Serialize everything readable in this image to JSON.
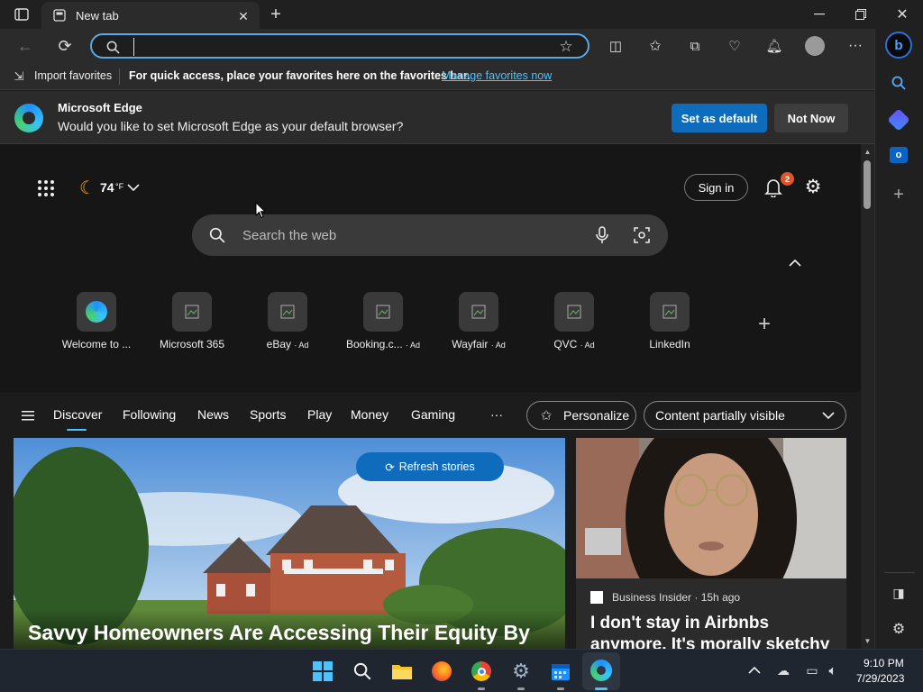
{
  "tab": {
    "title": "New tab"
  },
  "address": {
    "placeholder": "",
    "value": ""
  },
  "favorites": {
    "import_label": "Import favorites",
    "hint": "For quick access, place your favorites here on the favorites bar.",
    "manage_link": "Manage favorites now"
  },
  "infobar": {
    "title": "Microsoft Edge",
    "message": "Would you like to set Microsoft Edge as your default browser?",
    "primary": "Set as default",
    "secondary": "Not Now"
  },
  "ntp": {
    "weather": "74",
    "weather_unit": "°F",
    "sign_in": "Sign in",
    "notification_count": "2",
    "search_placeholder": "Search the web",
    "top_sites": [
      {
        "label": "Welcome to ...",
        "ad": ""
      },
      {
        "label": "Microsoft 365",
        "ad": ""
      },
      {
        "label": "eBay",
        "ad": "· Ad"
      },
      {
        "label": "Booking.c...",
        "ad": "· Ad"
      },
      {
        "label": "Wayfair",
        "ad": "· Ad"
      },
      {
        "label": "QVC",
        "ad": "· Ad"
      },
      {
        "label": "LinkedIn",
        "ad": ""
      }
    ],
    "nav_tabs": [
      "Discover",
      "Following",
      "News",
      "Sports",
      "Play",
      "Money",
      "Gaming"
    ],
    "more": "···",
    "personalize": "Personalize",
    "content_visibility": "Content partially visible",
    "refresh": "Refresh stories",
    "main_story_title": "Savvy Homeowners Are Accessing Their Equity By",
    "side_story": {
      "source": "Business Insider · 15h ago",
      "title": "I don't stay in Airbnbs anymore. It's morally sketchy"
    }
  },
  "taskbar": {
    "time": "9:10 PM",
    "date": "7/29/2023"
  },
  "colors": {
    "accent": "#0f6cbd",
    "link": "#4cc2ff",
    "badge": "#e0562b"
  }
}
